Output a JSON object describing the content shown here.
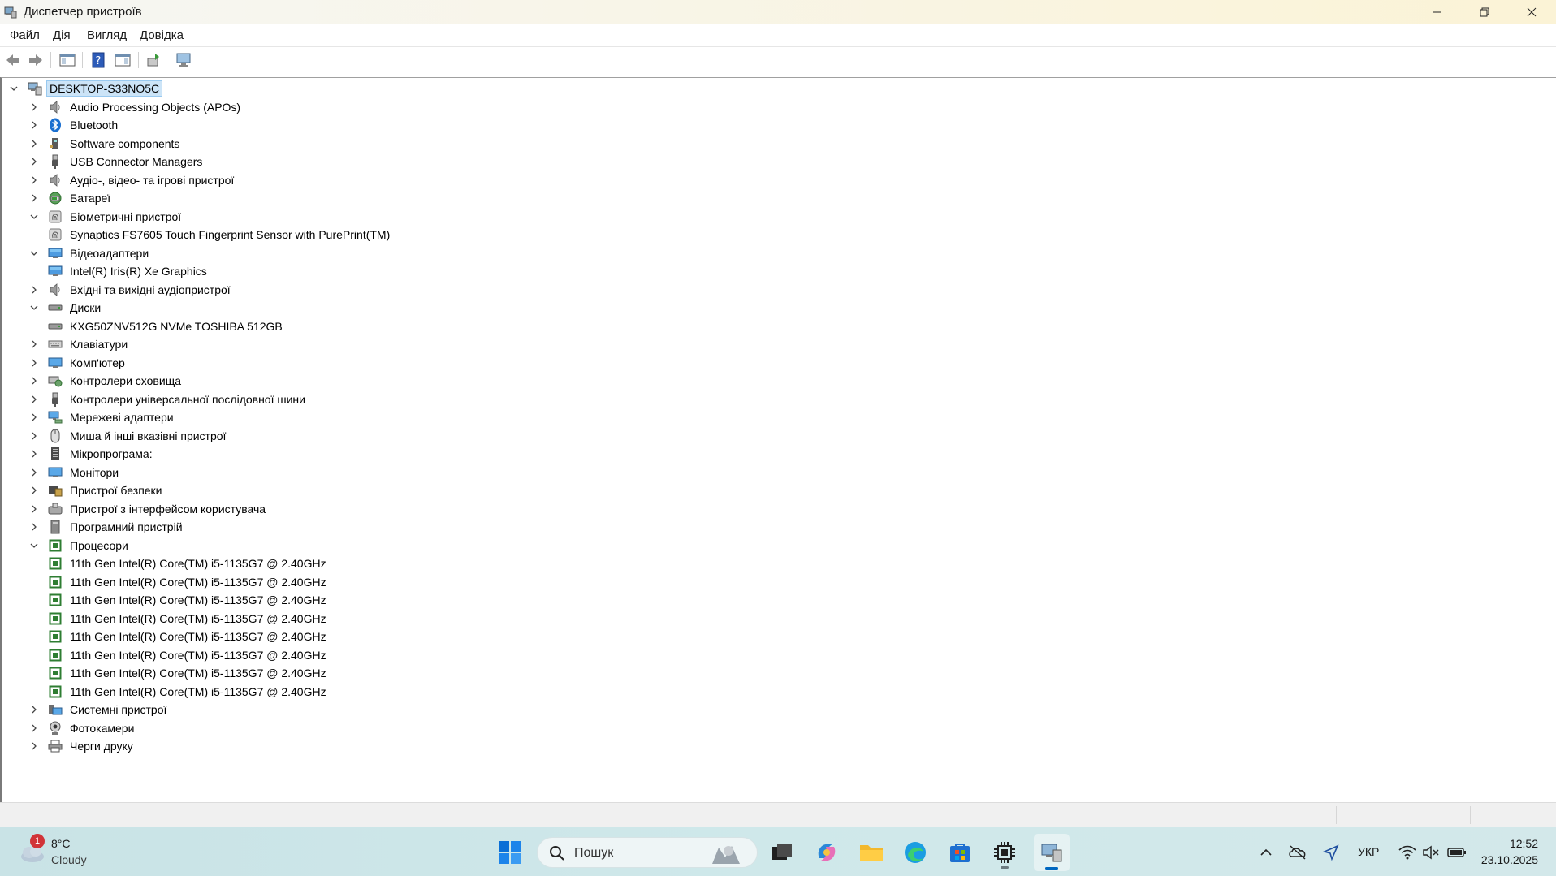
{
  "window": {
    "title": "Диспетчер пристроїв"
  },
  "menu": [
    "Файл",
    "Дія",
    "Вигляд",
    "Довідка"
  ],
  "tree": [
    {
      "label": "DESKTOP-S33NO5C",
      "level": 0,
      "state": "expanded",
      "icon": "computer-root-icon",
      "selected": true
    },
    {
      "label": "Audio Processing Objects (APOs)",
      "level": 1,
      "state": "collapsed",
      "icon": "speaker-icon"
    },
    {
      "label": "Bluetooth",
      "level": 1,
      "state": "collapsed",
      "icon": "bluetooth-icon"
    },
    {
      "label": "Software components",
      "level": 1,
      "state": "collapsed",
      "icon": "software-component-icon"
    },
    {
      "label": "USB Connector Managers",
      "level": 1,
      "state": "collapsed",
      "icon": "usb-icon"
    },
    {
      "label": "Аудіо-, відео- та ігрові пристрої",
      "level": 1,
      "state": "collapsed",
      "icon": "speaker-icon"
    },
    {
      "label": "Батареї",
      "level": 1,
      "state": "collapsed",
      "icon": "battery-icon"
    },
    {
      "label": "Біометричні пристрої",
      "level": 1,
      "state": "expanded",
      "icon": "fingerprint-icon"
    },
    {
      "label": "Synaptics FS7605 Touch Fingerprint Sensor with PurePrint(TM)",
      "level": 2,
      "state": "leaf",
      "icon": "fingerprint-icon"
    },
    {
      "label": "Відеоадаптери",
      "level": 1,
      "state": "expanded",
      "icon": "display-adapter-icon"
    },
    {
      "label": "Intel(R) Iris(R) Xe Graphics",
      "level": 2,
      "state": "leaf",
      "icon": "display-adapter-icon"
    },
    {
      "label": "Вхідні та вихідні аудіопристрої",
      "level": 1,
      "state": "collapsed",
      "icon": "speaker-icon"
    },
    {
      "label": "Диски",
      "level": 1,
      "state": "expanded",
      "icon": "disk-icon"
    },
    {
      "label": "KXG50ZNV512G NVMe TOSHIBA 512GB",
      "level": 2,
      "state": "leaf",
      "icon": "disk-icon"
    },
    {
      "label": "Клавіатури",
      "level": 1,
      "state": "collapsed",
      "icon": "keyboard-icon"
    },
    {
      "label": "Комп'ютер",
      "level": 1,
      "state": "collapsed",
      "icon": "monitor-icon"
    },
    {
      "label": "Контролери сховища",
      "level": 1,
      "state": "collapsed",
      "icon": "storage-controller-icon"
    },
    {
      "label": "Контролери універсальної послідовної шини",
      "level": 1,
      "state": "collapsed",
      "icon": "usb-icon"
    },
    {
      "label": "Мережеві адаптери",
      "level": 1,
      "state": "collapsed",
      "icon": "network-adapter-icon"
    },
    {
      "label": "Миша й інші вказівні пристрої",
      "level": 1,
      "state": "collapsed",
      "icon": "mouse-icon"
    },
    {
      "label": "Мікропрограма:",
      "level": 1,
      "state": "collapsed",
      "icon": "firmware-icon"
    },
    {
      "label": "Монітори",
      "level": 1,
      "state": "collapsed",
      "icon": "monitor-icon"
    },
    {
      "label": "Пристрої безпеки",
      "level": 1,
      "state": "collapsed",
      "icon": "security-device-icon"
    },
    {
      "label": "Пристрої з інтерфейсом користувача",
      "level": 1,
      "state": "collapsed",
      "icon": "hid-icon"
    },
    {
      "label": "Програмний пристрій",
      "level": 1,
      "state": "collapsed",
      "icon": "software-device-icon"
    },
    {
      "label": "Процесори",
      "level": 1,
      "state": "expanded",
      "icon": "processor-icon"
    },
    {
      "label": "11th Gen Intel(R) Core(TM) i5-1135G7 @ 2.40GHz",
      "level": 2,
      "state": "leaf",
      "icon": "processor-icon"
    },
    {
      "label": "11th Gen Intel(R) Core(TM) i5-1135G7 @ 2.40GHz",
      "level": 2,
      "state": "leaf",
      "icon": "processor-icon"
    },
    {
      "label": "11th Gen Intel(R) Core(TM) i5-1135G7 @ 2.40GHz",
      "level": 2,
      "state": "leaf",
      "icon": "processor-icon"
    },
    {
      "label": "11th Gen Intel(R) Core(TM) i5-1135G7 @ 2.40GHz",
      "level": 2,
      "state": "leaf",
      "icon": "processor-icon"
    },
    {
      "label": "11th Gen Intel(R) Core(TM) i5-1135G7 @ 2.40GHz",
      "level": 2,
      "state": "leaf",
      "icon": "processor-icon"
    },
    {
      "label": "11th Gen Intel(R) Core(TM) i5-1135G7 @ 2.40GHz",
      "level": 2,
      "state": "leaf",
      "icon": "processor-icon"
    },
    {
      "label": "11th Gen Intel(R) Core(TM) i5-1135G7 @ 2.40GHz",
      "level": 2,
      "state": "leaf",
      "icon": "processor-icon"
    },
    {
      "label": "11th Gen Intel(R) Core(TM) i5-1135G7 @ 2.40GHz",
      "level": 2,
      "state": "leaf",
      "icon": "processor-icon"
    },
    {
      "label": "Системні пристрої",
      "level": 1,
      "state": "collapsed",
      "icon": "system-device-icon"
    },
    {
      "label": "Фотокамери",
      "level": 1,
      "state": "collapsed",
      "icon": "camera-icon"
    },
    {
      "label": "Черги друку",
      "level": 1,
      "state": "collapsed",
      "icon": "printer-icon"
    }
  ],
  "taskbar": {
    "weather": {
      "temp": "8°C",
      "desc": "Cloudy",
      "badge": "1"
    },
    "search_placeholder": "Пошук",
    "language": "УКР",
    "time": "12:52",
    "date": "23.10.2025"
  },
  "colors": {
    "selection": "#cce4f7",
    "processor": "#2e7d32",
    "accent": "#0067c0"
  }
}
